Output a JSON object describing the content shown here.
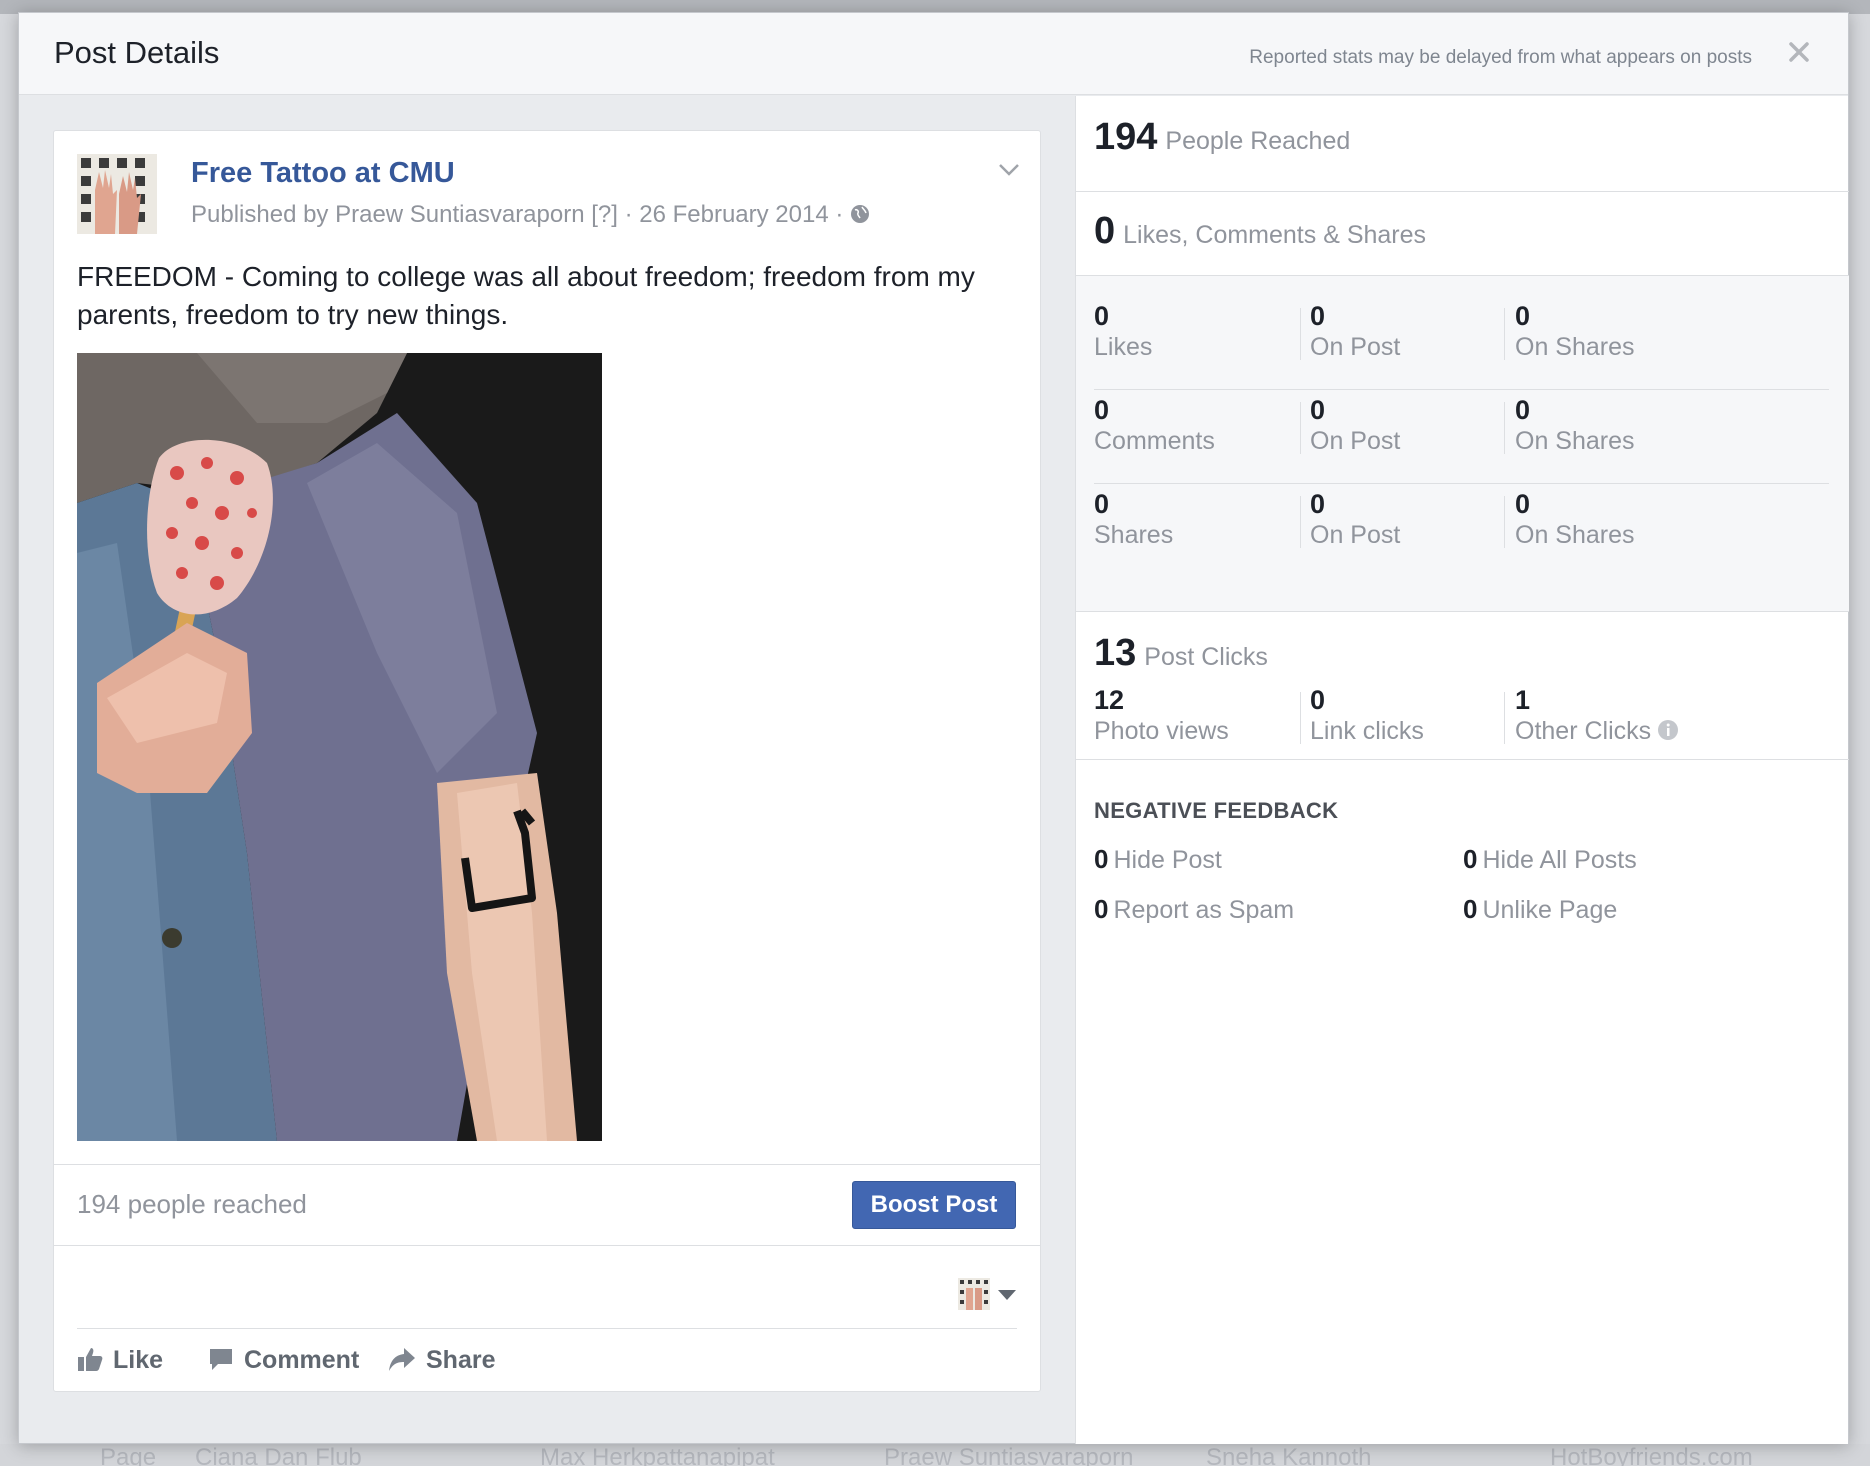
{
  "background": {
    "bottom_names": [
      "Page",
      "Ciana Dan Flub",
      "Max Herkpattanapipat",
      "Praew Suntiasvaraporn",
      "Sneha Kannoth",
      "HotBoyfriends.com"
    ]
  },
  "dialog": {
    "title": "Post Details",
    "note": "Reported stats may be delayed from what appears on posts",
    "close_icon": "close-icon"
  },
  "post": {
    "page_name": "Free Tattoo at CMU",
    "meta": "Published by Praew Suntiasvaraporn [?] · 26 February 2014 ·",
    "text": "FREEDOM - Coming to college was all about freedom; freedom from my parents, freedom to try new things.",
    "reach_text": "194 people reached",
    "boost_label": "Boost Post",
    "actions": {
      "like": "Like",
      "comment": "Comment",
      "share": "Share"
    }
  },
  "stats": {
    "reached": {
      "value": "194",
      "label": "People Reached"
    },
    "engagement": {
      "value": "0",
      "label": "Likes, Comments & Shares"
    },
    "rows": [
      {
        "cells": [
          {
            "value": "0",
            "label": "Likes"
          },
          {
            "value": "0",
            "label": "On Post"
          },
          {
            "value": "0",
            "label": "On Shares"
          }
        ]
      },
      {
        "cells": [
          {
            "value": "0",
            "label": "Comments"
          },
          {
            "value": "0",
            "label": "On Post"
          },
          {
            "value": "0",
            "label": "On Shares"
          }
        ]
      },
      {
        "cells": [
          {
            "value": "0",
            "label": "Shares"
          },
          {
            "value": "0",
            "label": "On Post"
          },
          {
            "value": "0",
            "label": "On Shares"
          }
        ]
      }
    ],
    "clicks": {
      "value": "13",
      "label": "Post Clicks",
      "cells": [
        {
          "value": "12",
          "label": "Photo views"
        },
        {
          "value": "0",
          "label": "Link clicks"
        },
        {
          "value": "1",
          "label": "Other Clicks"
        }
      ]
    },
    "negative": {
      "title": "NEGATIVE FEEDBACK",
      "items": [
        {
          "value": "0",
          "label": "Hide Post"
        },
        {
          "value": "0",
          "label": "Hide All Posts"
        },
        {
          "value": "0",
          "label": "Report as Spam"
        },
        {
          "value": "0",
          "label": "Unlike Page"
        }
      ]
    }
  },
  "colors": {
    "link": "#365899",
    "boost": "#4267b2",
    "muted": "#90949c"
  }
}
